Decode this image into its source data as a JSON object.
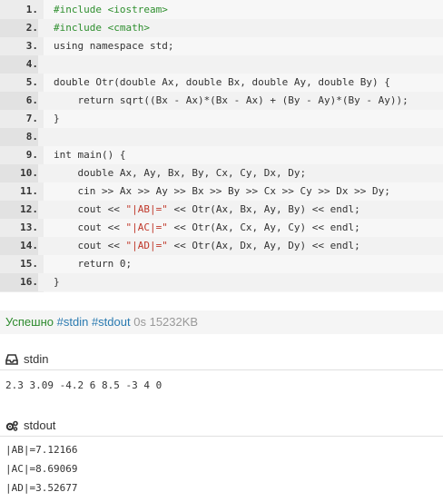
{
  "code": {
    "lines": [
      {
        "n": "1.",
        "t": "#include <iostream>"
      },
      {
        "n": "2.",
        "t": "#include <cmath>"
      },
      {
        "n": "3.",
        "t": "using namespace std;"
      },
      {
        "n": "4.",
        "t": ""
      },
      {
        "n": "5.",
        "t": "double Otr(double Ax, double Bx, double Ay, double By) {"
      },
      {
        "n": "6.",
        "t": "    return sqrt((Bx - Ax)*(Bx - Ax) + (By - Ay)*(By - Ay));"
      },
      {
        "n": "7.",
        "t": "}"
      },
      {
        "n": "8.",
        "t": ""
      },
      {
        "n": "9.",
        "t": "int main() {"
      },
      {
        "n": "10.",
        "t": "    double Ax, Ay, Bx, By, Cx, Cy, Dx, Dy;"
      },
      {
        "n": "11.",
        "t": "    cin >> Ax >> Ay >> Bx >> By >> Cx >> Cy >> Dx >> Dy;"
      },
      {
        "n": "12.",
        "t": "    cout << \"|AB|=\" << Otr(Ax, Bx, Ay, By) << endl;"
      },
      {
        "n": "13.",
        "t": "    cout << \"|AC|=\" << Otr(Ax, Cx, Ay, Cy) << endl;"
      },
      {
        "n": "14.",
        "t": "    cout << \"|AD|=\" << Otr(Ax, Dx, Ay, Dy) << endl;"
      },
      {
        "n": "15.",
        "t": "    return 0;"
      },
      {
        "n": "16.",
        "t": "}"
      }
    ]
  },
  "status": {
    "result": "Успешно",
    "tag_stdin": "#stdin",
    "tag_stdout": "#stdout",
    "time": "0s",
    "memory": "15232KB"
  },
  "stdin": {
    "title": "stdin",
    "icon": "inbox-icon",
    "content": "2.3 3.09 -4.2 6 8.5 -3 4 0"
  },
  "stdout": {
    "title": "stdout",
    "icon": "gears-icon",
    "lines": [
      "|AB|=7.12166",
      "|AC|=8.69069",
      "|AD|=3.52677"
    ]
  }
}
